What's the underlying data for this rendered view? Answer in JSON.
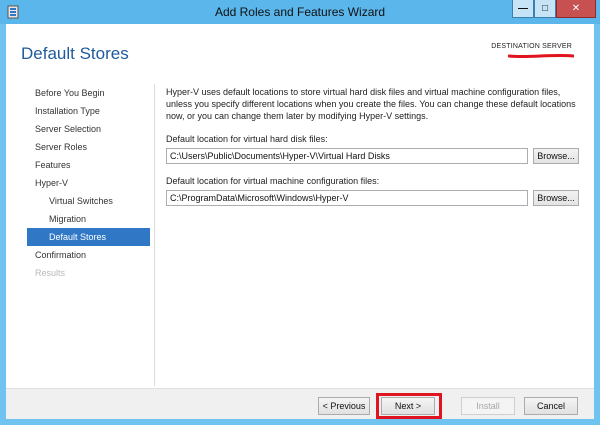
{
  "window": {
    "title": "Add Roles and Features Wizard",
    "controls": {
      "minimize": "—",
      "maximize": "□",
      "close": "✕"
    },
    "app_icon": "server-manager-icon"
  },
  "header": {
    "page_title": "Default Stores",
    "destination_label": "DESTINATION SERVER"
  },
  "nav": {
    "items": [
      {
        "label": "Before You Begin",
        "state": "normal"
      },
      {
        "label": "Installation Type",
        "state": "normal"
      },
      {
        "label": "Server Selection",
        "state": "normal"
      },
      {
        "label": "Server Roles",
        "state": "normal"
      },
      {
        "label": "Features",
        "state": "normal"
      },
      {
        "label": "Hyper-V",
        "state": "normal"
      },
      {
        "label": "Virtual Switches",
        "state": "sub"
      },
      {
        "label": "Migration",
        "state": "sub"
      },
      {
        "label": "Default Stores",
        "state": "active"
      },
      {
        "label": "Confirmation",
        "state": "normal"
      },
      {
        "label": "Results",
        "state": "disabled"
      }
    ]
  },
  "content": {
    "description": "Hyper-V uses default locations to store virtual hard disk files and virtual machine configuration files, unless you specify different locations when you create the files. You can change these default locations now, or you can change them later by modifying Hyper-V settings.",
    "vhd_label": "Default location for virtual hard disk files:",
    "vhd_value": "C:\\Users\\Public\\Documents\\Hyper-V\\Virtual Hard Disks",
    "vm_label": "Default location for virtual machine configuration files:",
    "vm_value": "C:\\ProgramData\\Microsoft\\Windows\\Hyper-V",
    "browse_label": "Browse..."
  },
  "footer": {
    "previous": "< Previous",
    "next": "Next >",
    "install": "Install",
    "cancel": "Cancel"
  },
  "colors": {
    "accent": "#3078c6",
    "title_blue": "#1f5a9e",
    "highlight_red": "#e0141e",
    "titlebar": "#5ab6eb"
  }
}
